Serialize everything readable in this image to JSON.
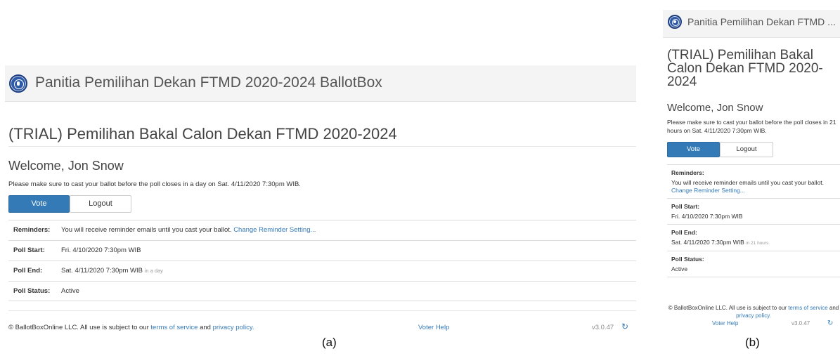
{
  "brand": {
    "full": "Panitia Pemilihan Dekan FTMD 2020-2024 BallotBox",
    "truncated": "Panitia Pemilihan Dekan FTMD ..."
  },
  "poll": {
    "title": "(TRIAL) Pemilihan Bakal Calon Dekan FTMD 2020-2024",
    "welcome": "Welcome, Jon Snow",
    "message_desktop": "Please make sure to cast your ballot before the poll closes in a day on Sat. 4/11/2020 7:30pm WIB.",
    "message_mobile": "Please make sure to cast your ballot before the poll closes in 21 hours on Sat. 4/11/2020 7:30pm WIB."
  },
  "buttons": {
    "vote": "Vote",
    "logout": "Logout"
  },
  "details": {
    "reminders_label": "Reminders:",
    "reminders_text": "You will receive reminder emails until you cast your ballot.",
    "reminders_link": "Change Reminder Setting...",
    "poll_start_label": "Poll Start:",
    "poll_start_value": "Fri. 4/10/2020 7:30pm WIB",
    "poll_end_label": "Poll End:",
    "poll_end_value": "Sat. 4/11/2020 7:30pm WIB",
    "poll_end_relative_desktop": "in a day",
    "poll_end_relative_mobile": "in 21 hours",
    "poll_status_label": "Poll Status:",
    "poll_status_value": "Active"
  },
  "footer": {
    "copyright_prefix": "© BallotBoxOnline LLC. All use is subject to our",
    "terms_link": "terms of service",
    "and": "and",
    "privacy_link": "privacy policy.",
    "voter_help": "Voter Help",
    "version": "v3.0.47"
  },
  "captions": {
    "a": "(a)",
    "b": "(b)"
  },
  "icons": {
    "logo": "university-seal-icon",
    "refresh": "refresh-icon"
  },
  "colors": {
    "primary": "#337ab7",
    "header_bg": "#f4f4f4",
    "logo": "#2f5aa8"
  }
}
